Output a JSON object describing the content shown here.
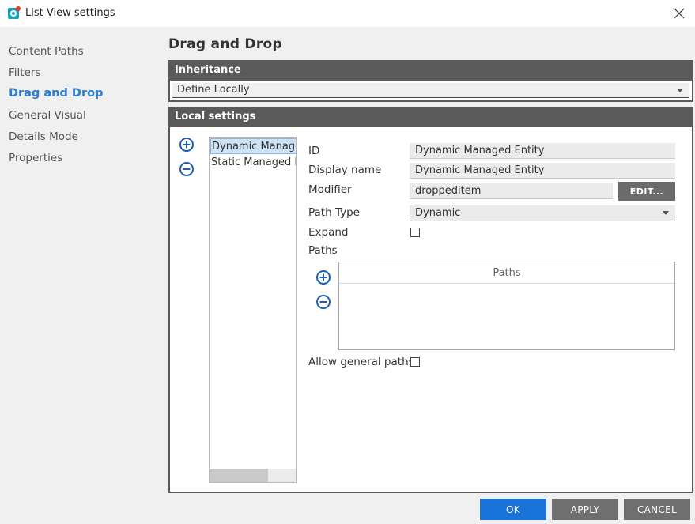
{
  "window": {
    "title": "List View settings",
    "close_icon": "close-icon"
  },
  "sidebar": {
    "items": [
      {
        "label": "Content Paths"
      },
      {
        "label": "Filters"
      },
      {
        "label": "Drag and Drop",
        "active": true
      },
      {
        "label": "General Visual"
      },
      {
        "label": "Details Mode"
      },
      {
        "label": "Properties"
      }
    ]
  },
  "main": {
    "title": "Drag and Drop",
    "inheritance": {
      "header": "Inheritance",
      "value": "Define Locally"
    },
    "local_settings": {
      "header": "Local settings",
      "list_items": [
        "Dynamic Managed Entity",
        "Static Managed Entity"
      ],
      "fields": {
        "id_label": "ID",
        "id_value": "Dynamic Managed Entity",
        "display_name_label": "Display name",
        "display_name_value": "Dynamic Managed Entity",
        "modifier_label": "Modifier",
        "modifier_value": "droppeditem",
        "edit_label": "EDIT...",
        "path_type_label": "Path Type",
        "path_type_value": "Dynamic",
        "expand_label": "Expand",
        "expand_checked": false,
        "paths_label": "Paths",
        "paths_column": "Paths",
        "allow_general_paths_label": "Allow general paths",
        "allow_general_paths_checked": false
      }
    }
  },
  "footer": {
    "ok": "OK",
    "apply": "APPLY",
    "cancel": "CANCEL"
  },
  "colors": {
    "accent": "#2a7dd1",
    "ok_button": "#1a73d9",
    "header_bar": "#5a5a5a"
  }
}
